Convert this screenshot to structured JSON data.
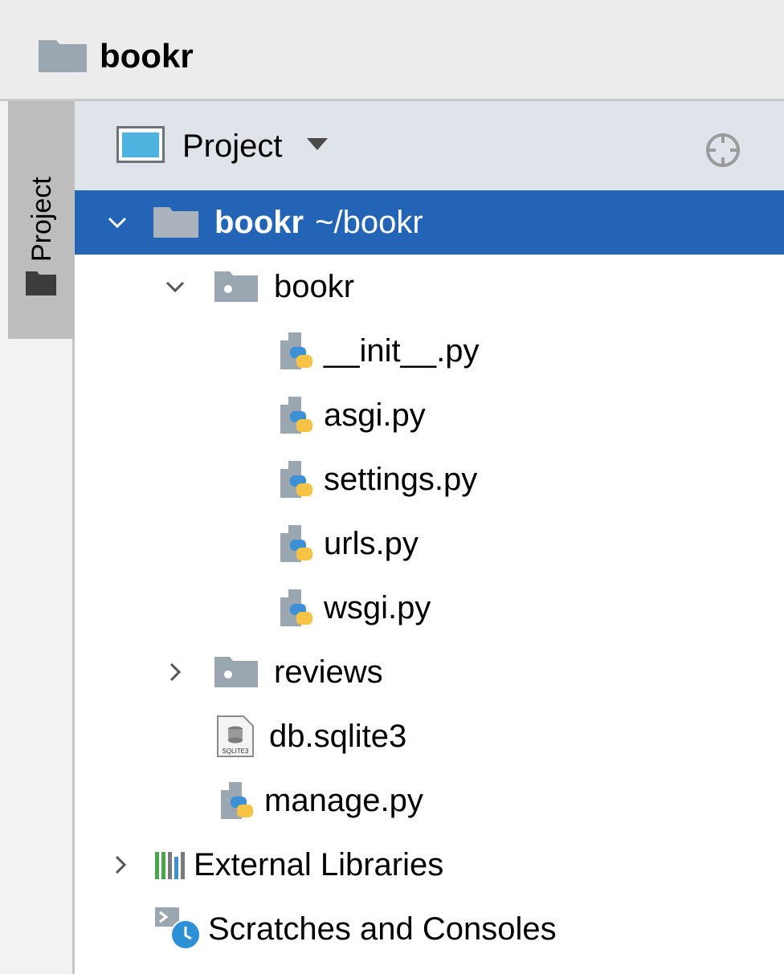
{
  "window": {
    "title": "bookr"
  },
  "side_tab": {
    "label": "Project"
  },
  "panel": {
    "view_label": "Project"
  },
  "tree": {
    "root": {
      "name": "bookr",
      "path": "~/bookr"
    },
    "bookr_dir": "bookr",
    "files": [
      "__init__.py",
      "asgi.py",
      "settings.py",
      "urls.py",
      "wsgi.py"
    ],
    "reviews_dir": "reviews",
    "db_file": "db.sqlite3",
    "db_icon_text": "SQLITE3",
    "manage_file": "manage.py",
    "external_libraries": "External Libraries",
    "scratches": "Scratches and Consoles"
  },
  "colors": {
    "selection": "#2364b6",
    "folder_gray": "#9aa7b0",
    "python_blue": "#3d8fd6",
    "python_yellow": "#f6c344",
    "clock_blue": "#2d8fd5"
  },
  "icons": [
    "folder-icon",
    "module-folder-icon",
    "python-file-icon",
    "sqlite-file-icon",
    "libraries-icon",
    "scratches-icon",
    "locate-icon",
    "chevron-down-icon",
    "chevron-right-icon",
    "dropdown-caret-icon",
    "project-window-icon"
  ]
}
